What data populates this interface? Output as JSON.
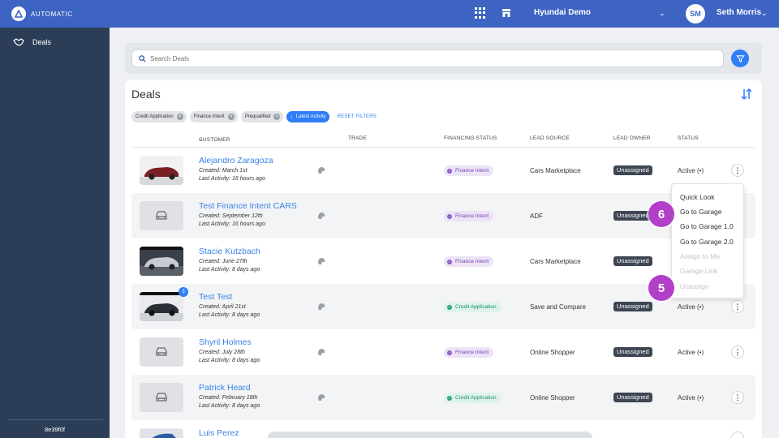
{
  "topbar": {
    "brand": "AUTOMATIC",
    "dealer": "Hyundai Demo",
    "avatar_initials": "SM",
    "user_name": "Seth Morris"
  },
  "sidebar": {
    "items": [
      {
        "label": "Deals"
      }
    ],
    "version": "8e39f0f"
  },
  "search": {
    "placeholder": "Search Deals"
  },
  "deals": {
    "title": "Deals",
    "filters": [
      "Credit Application",
      "Finance Intent",
      "Prequalified"
    ],
    "active_sort": "Latest Activity",
    "reset_label": "RESET FILTERS",
    "columns": {
      "customer": "CUSTOMER",
      "trade": "TRADE",
      "financing_status": "FINANCING STATUS",
      "lead_source": "LEAD SOURCE",
      "lead_owner": "LEAD OWNER",
      "status": "STATUS"
    },
    "rows": [
      {
        "name": "Alejandro Zaragoza",
        "created": "Created: March 1st",
        "activity": "Last Activity: 16 hours ago",
        "financing": "Finance Intent",
        "lead_source": "Cars Marketplace",
        "owner": "Unassigned",
        "status": "Active"
      },
      {
        "name": "Test Finance Intent CARS",
        "created": "Created: September 12th",
        "activity": "Last Activity: 16 hours ago",
        "financing": "Finance Intent",
        "lead_source": "ADF",
        "owner": "Unassigned",
        "status": ""
      },
      {
        "name": "Stacie Kutzbach",
        "created": "Created: June 27th",
        "activity": "Last Activity: 8 days ago",
        "financing": "Finance Intent",
        "lead_source": "Cars Marketplace",
        "owner": "Unassigned",
        "status": ""
      },
      {
        "name": "Test Test",
        "created": "Created: April 21st",
        "activity": "Last Activity: 8 days ago",
        "financing": "Credit Application",
        "lead_source": "Save and Compare",
        "owner": "Unassigned",
        "status": "Active",
        "badge": "3"
      },
      {
        "name": "Shyril Holmes",
        "created": "Created: July 28th",
        "activity": "Last Activity: 8 days ago",
        "financing": "Finance Intent",
        "lead_source": "Online Shopper",
        "owner": "Unassigned",
        "status": "Active"
      },
      {
        "name": "Patrick Heard",
        "created": "Created: February 18th",
        "activity": "Last Activity: 8 days ago",
        "financing": "Credit Application",
        "lead_source": "Online Shopper",
        "owner": "Unassigned",
        "status": "Active"
      },
      {
        "name": "Luis Perez"
      }
    ]
  },
  "menu": {
    "items": [
      {
        "label": "Quick Look"
      },
      {
        "label": "Go to Garage"
      },
      {
        "label": "Go to Garage 1.0"
      },
      {
        "label": "Go to Garage 2.0"
      },
      {
        "label": "Assign to Me"
      },
      {
        "label": "Garage Link"
      },
      {
        "label": "Unassign"
      }
    ]
  },
  "steps": {
    "six": "6",
    "five": "5"
  },
  "colors": {
    "primary": "#3d64c2",
    "accent": "#2f7ef7",
    "sidebar": "#2c3e57",
    "step": "#b23fc8"
  }
}
